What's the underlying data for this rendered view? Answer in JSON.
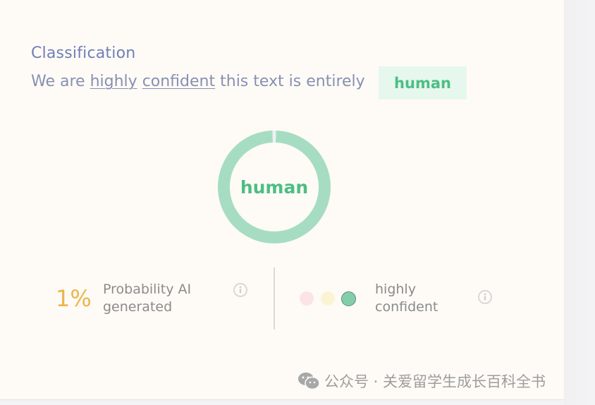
{
  "classification": {
    "heading": "Classification",
    "sentence_prefix": "We are",
    "confidence_word_1": "highly",
    "confidence_word_2": "confident",
    "sentence_suffix": "this text is entirely",
    "result_badge": "human"
  },
  "donut": {
    "label": "human",
    "human_fraction": 0.99,
    "ai_fraction": 0.01,
    "human_color": "#a6ddc2",
    "ai_color": "#eef1f3"
  },
  "stats": {
    "probability_value": "1%",
    "probability_label_line1": "Probability AI",
    "probability_label_line2": "generated",
    "confidence_label_line1": "highly",
    "confidence_label_line2": "confident",
    "confidence_dots": [
      {
        "level": "low",
        "color": "#fce4e6",
        "active": false
      },
      {
        "level": "medium",
        "color": "#fbf3d3",
        "active": false
      },
      {
        "level": "high",
        "color": "#82ceab",
        "active": true
      }
    ]
  },
  "colors": {
    "accent_green": "#4dbe84",
    "percent_orange": "#ecb44c",
    "heading_blue": "#6f7fb8"
  },
  "watermark": {
    "icon": "wechat-icon",
    "text": "公众号 · 关爱留学生成长百科全书"
  }
}
